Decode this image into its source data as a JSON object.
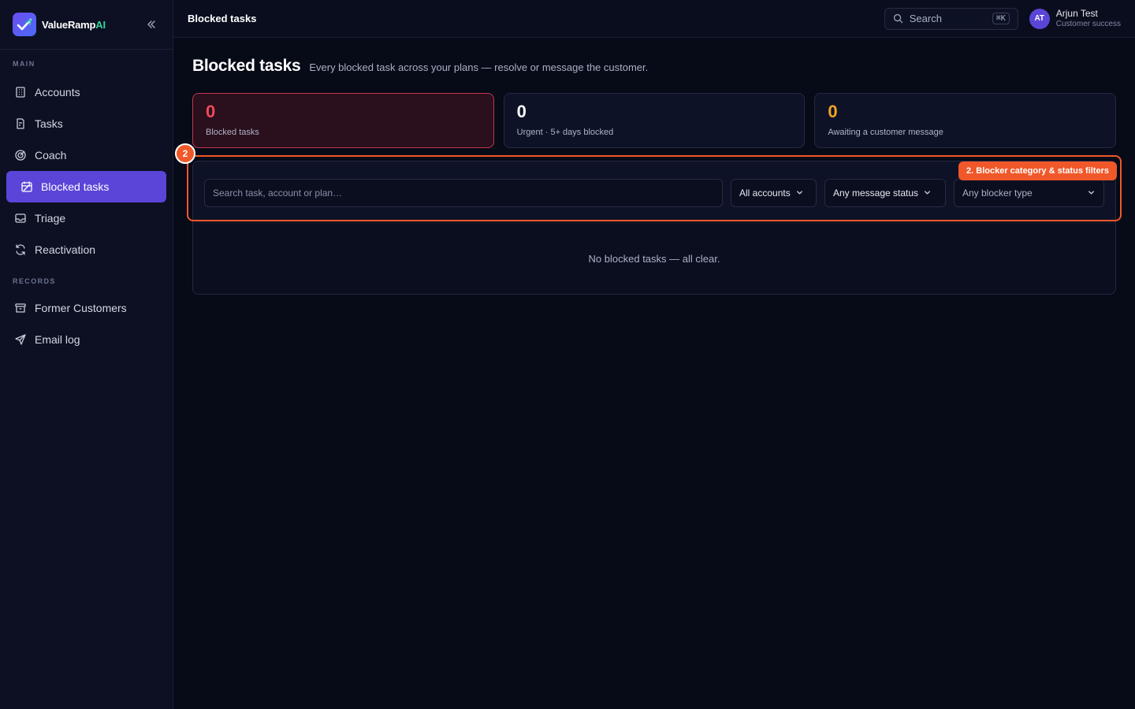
{
  "brand": {
    "name": "ValueRamp",
    "name_suffix": "AI"
  },
  "sidebar": {
    "sections": [
      {
        "label": "MAIN"
      },
      {
        "label": "RECORDS"
      }
    ],
    "items": [
      {
        "label": "Accounts",
        "icon": "building-icon"
      },
      {
        "label": "Tasks",
        "icon": "clipboard-icon"
      },
      {
        "label": "Coach",
        "icon": "target-icon"
      },
      {
        "label": "Blocked tasks",
        "icon": "blocked-calendar-icon",
        "active": true
      },
      {
        "label": "Triage",
        "icon": "inbox-icon"
      },
      {
        "label": "Reactivation",
        "icon": "refresh-icon"
      },
      {
        "label": "Former Customers",
        "icon": "archive-icon"
      },
      {
        "label": "Email log",
        "icon": "send-icon"
      }
    ]
  },
  "topbar": {
    "title": "Blocked tasks",
    "search_label": "Search",
    "search_shortcut": "⌘K",
    "user": {
      "initials": "AT",
      "name": "Arjun Test",
      "role": "Customer success"
    }
  },
  "page": {
    "title": "Blocked tasks",
    "subtitle": "Every blocked task across your plans — resolve or message the customer."
  },
  "stats": [
    {
      "value": "0",
      "label": "Blocked tasks",
      "color": "#f04a5a"
    },
    {
      "value": "0",
      "label": "Urgent · 5+ days blocked",
      "color": "#ffffff"
    },
    {
      "value": "0",
      "label": "Awaiting a customer message",
      "color": "#f5a524"
    }
  ],
  "filters": {
    "search_placeholder": "Search task, account or plan…",
    "accounts": "All accounts",
    "message_status": "Any message status",
    "blocker_type": "Any blocker type"
  },
  "annotation": {
    "step": "2",
    "callout": "2. Blocker category & status filters",
    "color": "#f0582a"
  },
  "empty_state": "No blocked tasks — all clear."
}
